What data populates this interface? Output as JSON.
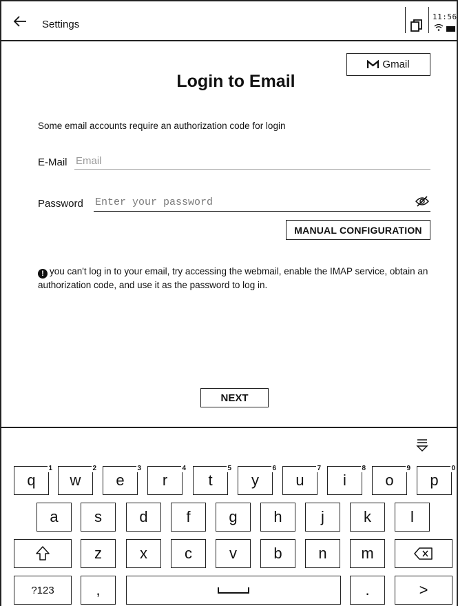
{
  "topbar": {
    "title": "Settings",
    "clock": "11:56",
    "icons": [
      "back-arrow-icon",
      "window-icon",
      "wifi-icon",
      "battery-icon"
    ]
  },
  "gmail_button": {
    "label": "Gmail",
    "icon": "gmail-icon"
  },
  "title": "Login to Email",
  "note": "Some email accounts require an authorization code for login",
  "email": {
    "label": "E-Mail",
    "placeholder": "Email",
    "value": ""
  },
  "password": {
    "label": "Password",
    "placeholder": "Enter your password",
    "value": ""
  },
  "manual_config_label": "MANUAL CONFIGURATION",
  "info": {
    "icon": "!",
    "text": "you can't log in to your email, try accessing the webmail, enable the IMAP service, obtain an authorization code, and use it as the password to log in."
  },
  "next_label": "NEXT",
  "keyboard": {
    "row1": [
      {
        "k": "q",
        "s": "1"
      },
      {
        "k": "w",
        "s": "2"
      },
      {
        "k": "e",
        "s": "3"
      },
      {
        "k": "r",
        "s": "4"
      },
      {
        "k": "t",
        "s": "5"
      },
      {
        "k": "y",
        "s": "6"
      },
      {
        "k": "u",
        "s": "7"
      },
      {
        "k": "i",
        "s": "8"
      },
      {
        "k": "o",
        "s": "9"
      },
      {
        "k": "p",
        "s": "0"
      }
    ],
    "row2": [
      "a",
      "s",
      "d",
      "f",
      "g",
      "h",
      "j",
      "k",
      "l"
    ],
    "row3": [
      "z",
      "x",
      "c",
      "v",
      "b",
      "n",
      "m"
    ],
    "row4": {
      "symbols": "?123",
      "comma": ",",
      "period": ".",
      "enter": ">"
    }
  }
}
